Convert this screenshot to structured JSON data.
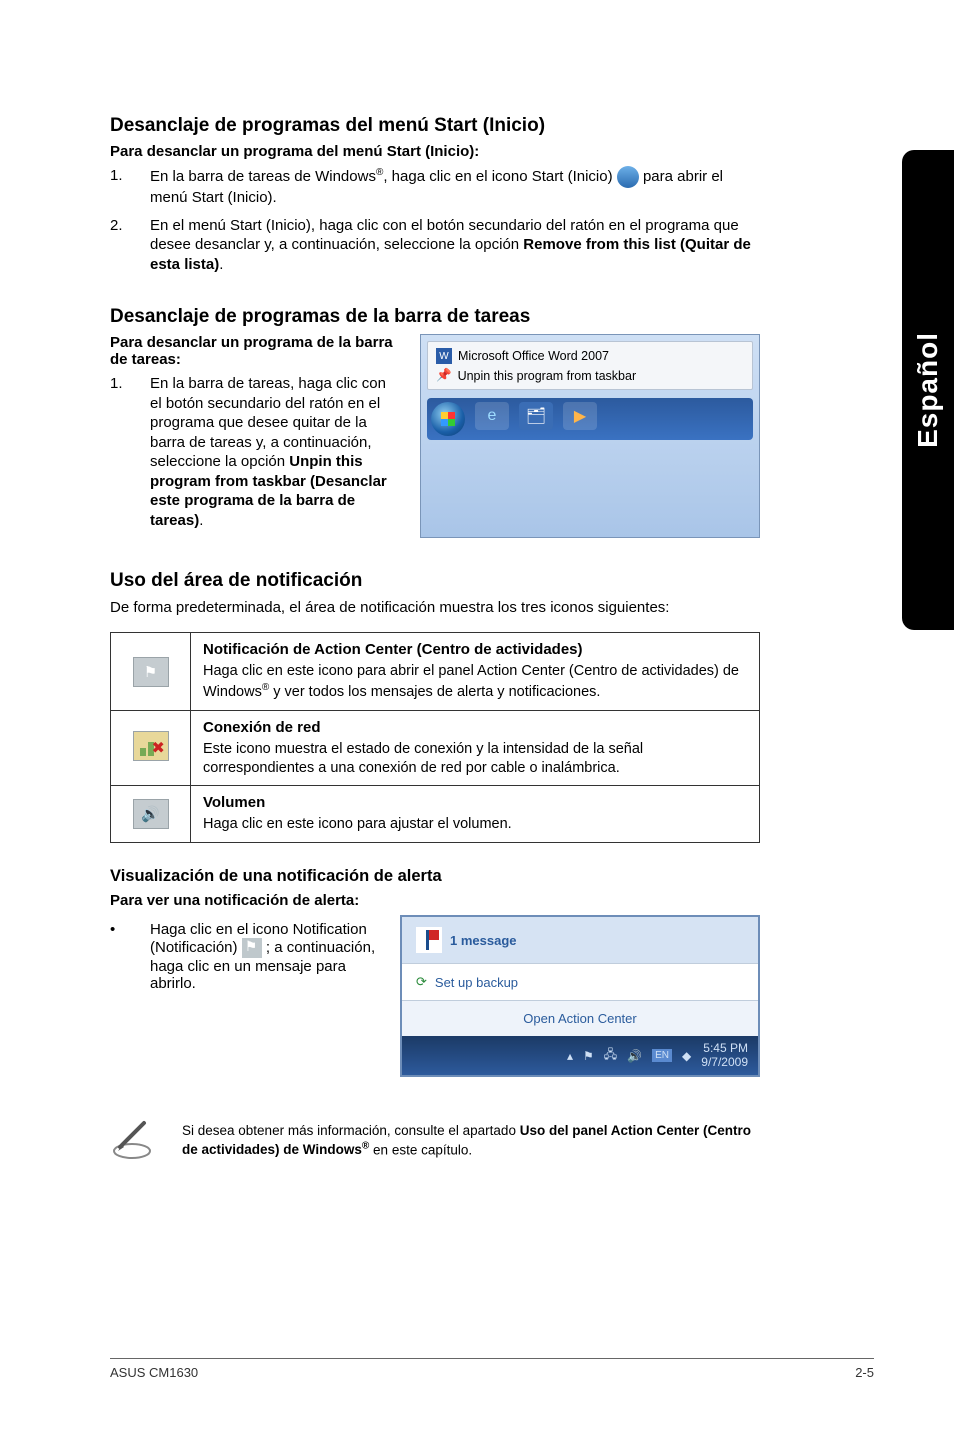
{
  "sideTab": "Español",
  "sec1": {
    "title": "Desanclaje de programas del menú Start (Inicio)",
    "sub": "Para desanclar un programa del menú Start (Inicio):",
    "step1_a": "En la barra de tareas de Windows",
    "step1_b": ", haga clic en el icono Start (Inicio) ",
    "step1_c": " para abrir el menú Start (Inicio).",
    "step2_a": "En el menú Start (Inicio), haga clic con el botón secundario del ratón en el programa que desee desanclar y, a continuación, seleccione la opción ",
    "step2_bold": "Remove from this list (Quitar de esta lista)",
    "step2_b": "."
  },
  "sec2": {
    "title": "Desanclaje de programas de la barra de tareas",
    "sub": "Para desanclar un programa de la barra de tareas:",
    "step1_a": "En la barra de tareas, haga clic con el botón secundario del ratón en el programa que desee quitar de la barra de tareas y, a continuación, seleccione la opción ",
    "step1_bold": "Unpin this program from taskbar (Desanclar este programa de la barra de tareas)",
    "step1_b": ".",
    "menu1": "Microsoft Office Word 2007",
    "menu2": "Unpin this program from taskbar"
  },
  "sec3": {
    "title": "Uso del área de notificación",
    "intro": "De forma predeterminada, el área de notificación muestra los tres iconos siguientes:",
    "rows": [
      {
        "iconGlyph": "⚑",
        "title": "Notificación de Action Center (Centro de actividades)",
        "body_a": "Haga clic en este icono para abrir el panel Action Center (Centro de actividades) de Windows",
        "body_b": " y ver todos los mensajes de alerta y notificaciones."
      },
      {
        "iconGlyph": "🖧",
        "title": "Conexión de red",
        "body_a": "Este icono muestra el estado de conexión y la intensidad de la señal correspondientes a una conexión de red por cable o inalámbrica.",
        "body_b": ""
      },
      {
        "iconGlyph": "🔊",
        "title": "Volumen",
        "body_a": "Haga clic en este icono para ajustar el volumen.",
        "body_b": ""
      }
    ]
  },
  "sec4": {
    "title": "Visualización de una notificación de alerta",
    "sub": "Para ver una notificación de alerta:",
    "bullet_a": "Haga clic en el icono Notification (Notificación) ",
    "bullet_b": " ; a continuación, haga clic en un mensaje para abrirlo.",
    "msg": "1 message",
    "setup": "Set up backup",
    "open": "Open Action Center",
    "time": "5:45 PM",
    "date": "9/7/2009"
  },
  "note": {
    "a": "Si desea obtener más información, consulte el apartado ",
    "bold": "Uso del panel Action Center (Centro de actividades) de Windows",
    "b": " en este capítulo."
  },
  "footer": {
    "left": "ASUS CM1630",
    "right": "2-5"
  },
  "reg": "®"
}
